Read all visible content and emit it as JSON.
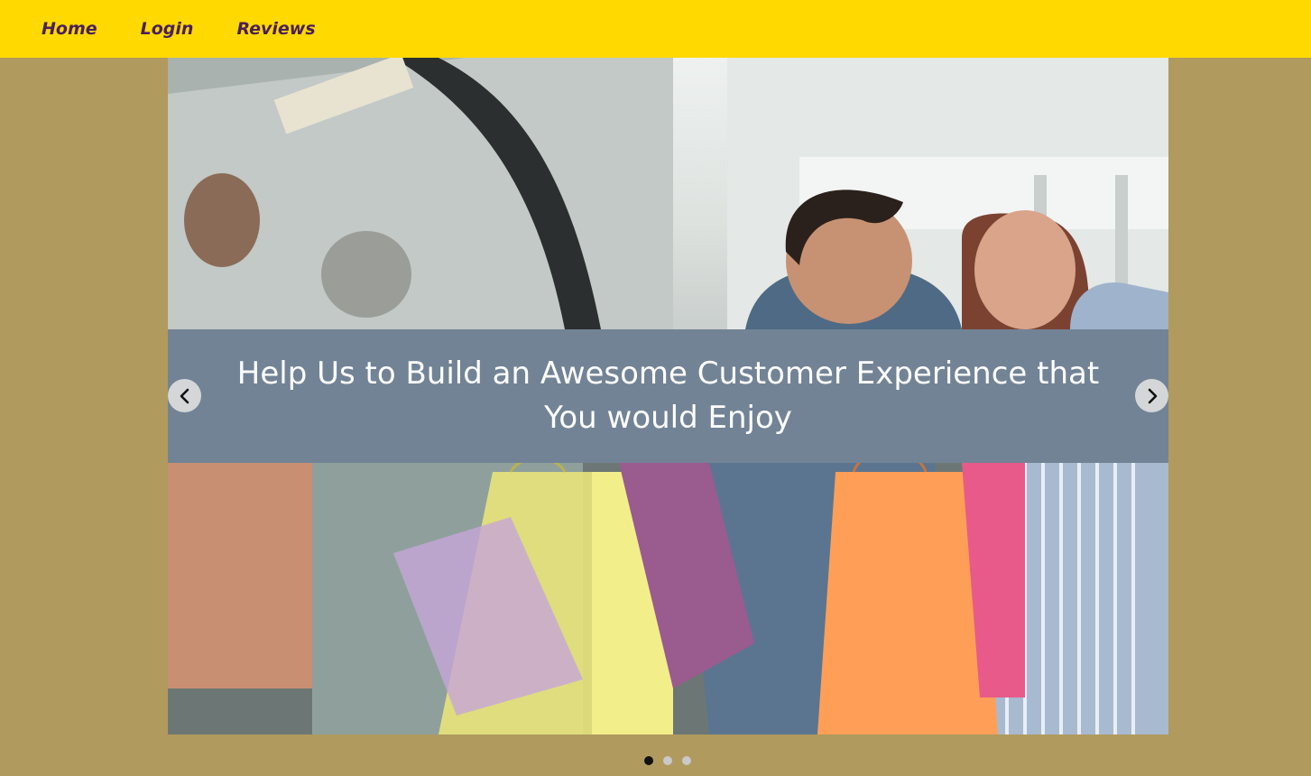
{
  "nav": {
    "items": [
      {
        "label": "Home"
      },
      {
        "label": "Login"
      },
      {
        "label": "Reviews"
      }
    ]
  },
  "hero": {
    "caption": "Help Us to Build an Awesome Customer Experience that You would Enjoy",
    "slide_count": 3,
    "active_slide": 1,
    "prev_icon": "chevron-left-icon",
    "next_icon": "chevron-right-icon"
  },
  "colors": {
    "navbar": "#ffd900",
    "nav_link": "#4a1f5c",
    "page_background": "#b09a5e",
    "caption_background": "#728396",
    "caption_text": "#ffffff",
    "active_dot": "#111111",
    "inactive_dot": "#c9c9c9"
  }
}
